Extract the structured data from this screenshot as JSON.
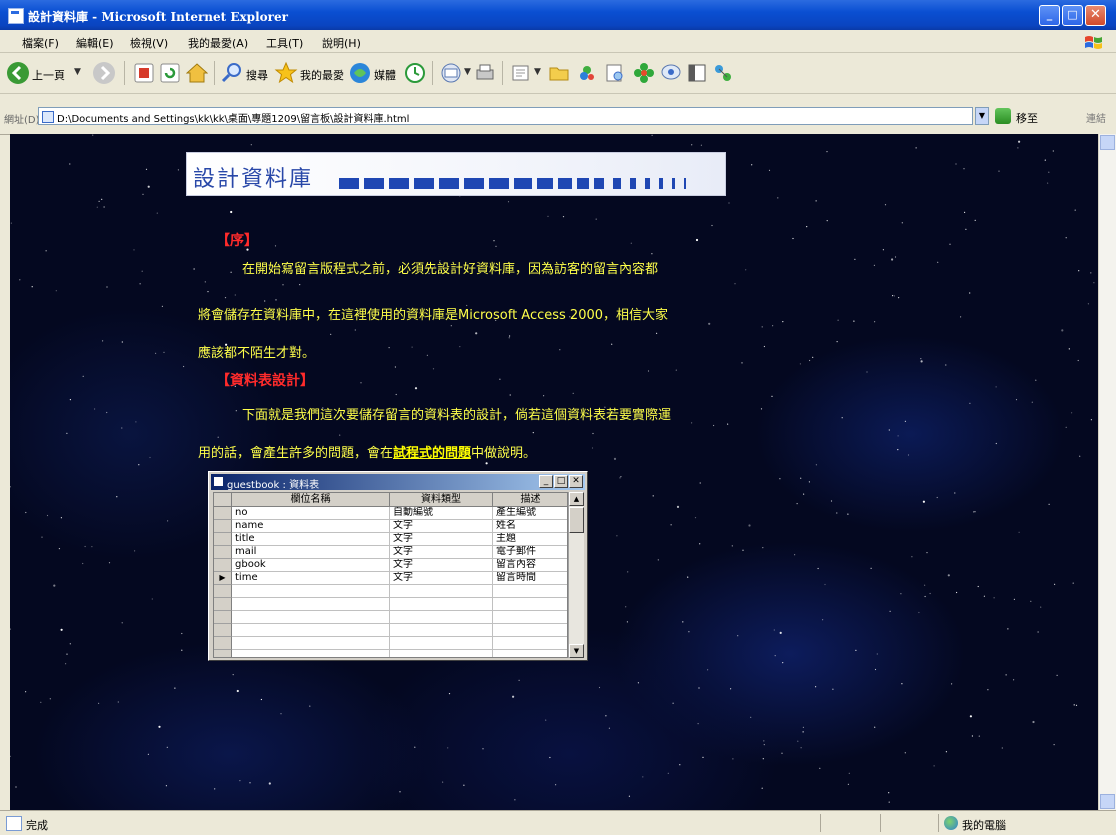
{
  "window": {
    "title": "設計資料庫 - Microsoft Internet Explorer",
    "minimize": "_",
    "maximize": "□",
    "close": "✕"
  },
  "menu": [
    "檔案(F)",
    "編輯(E)",
    "檢視(V)",
    "我的最愛(A)",
    "工具(T)",
    "說明(H)"
  ],
  "toolbar": {
    "back_label": "上一頁",
    "search_label": "搜尋",
    "favorites_label": "我的最愛",
    "media_label": "媒體"
  },
  "address": {
    "label": "網址(D)",
    "url": "D:\\Documents and Settings\\kk\\kk\\桌面\\專題1209\\留言板\\設計資料庫.html",
    "go_label": "移至",
    "links_label": "連結"
  },
  "page": {
    "banner_title": "設計資料庫",
    "section1_heading": "【序】",
    "section1_lines": [
      "在開始寫留言版程式之前，必須先設計好資料庫，因為訪客的留言內容都",
      "將會儲存在資料庫中，在這裡使用的資料庫是Microsoft Access 2000，相信大家",
      "應該都不陌生才對。"
    ],
    "section2_heading": "【資料表設計】",
    "section2_line1": "下面就是我們這次要儲存留言的資料表的設計，倘若這個資料表若要實際運",
    "section2_line2_prefix": "用的話，會產生許多的問題，會在",
    "section2_link": "試程式的問題",
    "section2_line2_suffix": "中做說明。"
  },
  "db_table": {
    "title": "guestbook : 資料表",
    "columns": [
      "欄位名稱",
      "資料類型",
      "描述"
    ],
    "rows": [
      [
        "no",
        "自動編號",
        "產生編號"
      ],
      [
        "name",
        "文字",
        "姓名"
      ],
      [
        "title",
        "文字",
        "主題"
      ],
      [
        "mail",
        "文字",
        "電子郵件"
      ],
      [
        "gbook",
        "文字",
        "留言內容"
      ],
      [
        "time",
        "文字",
        "留言時間"
      ]
    ],
    "empty_rows": 4,
    "current_row_marker": "▶"
  },
  "status": {
    "text": "完成",
    "zone": "我的電腦"
  }
}
